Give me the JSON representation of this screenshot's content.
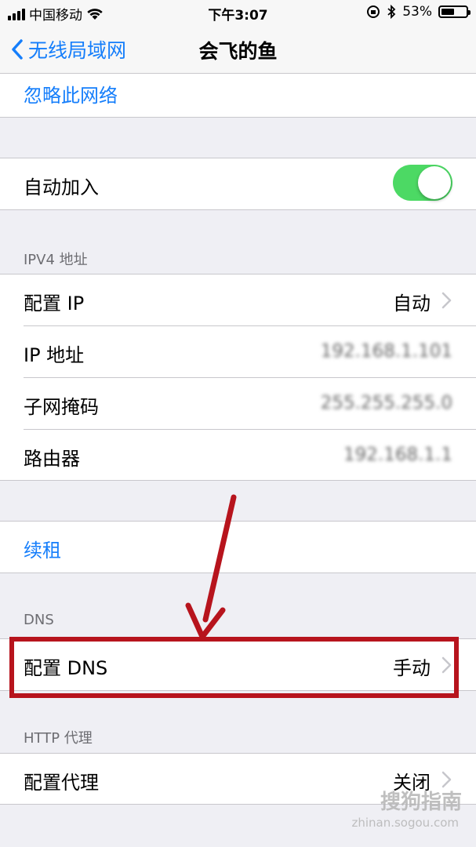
{
  "status_bar": {
    "carrier": "中国移动",
    "time": "下午3:07",
    "battery_percent": "53%",
    "battery_level": 0.53
  },
  "nav": {
    "back_label": "无线局域网",
    "title": "会飞的鱼"
  },
  "forget_network": "忽略此网络",
  "auto_join": {
    "label": "自动加入",
    "enabled": true
  },
  "ipv4": {
    "header": "IPV4 地址",
    "rows": [
      {
        "label": "配置 IP",
        "value": "自动",
        "has_chevron": true
      },
      {
        "label": "IP 地址",
        "value": "192.168.1.101",
        "blurred": true
      },
      {
        "label": "子网掩码",
        "value": "255.255.255.0",
        "blurred": true
      },
      {
        "label": "路由器",
        "value": "192.168.1.1",
        "blurred": true
      }
    ]
  },
  "renew_lease": "续租",
  "dns": {
    "header": "DNS",
    "row": {
      "label": "配置 DNS",
      "value": "手动",
      "has_chevron": true
    }
  },
  "http_proxy": {
    "header": "HTTP 代理",
    "row": {
      "label": "配置代理",
      "value": "关闭",
      "has_chevron": true
    }
  },
  "watermark": {
    "text": "搜狗指南",
    "sub": "zhinan.sogou.com"
  },
  "colors": {
    "accent": "#157efb",
    "toggle_on": "#4cd964",
    "annotation": "#b7141d"
  }
}
